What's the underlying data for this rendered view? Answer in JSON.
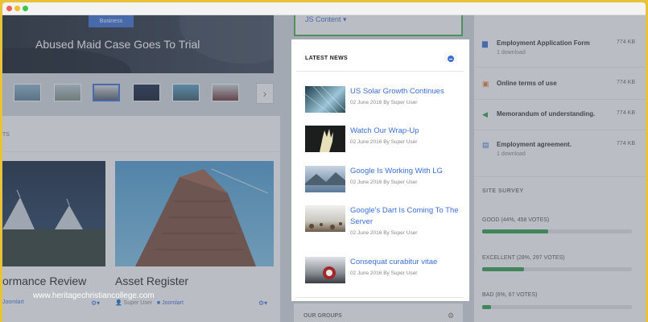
{
  "window": {
    "controls": [
      "close",
      "minimize",
      "maximize"
    ]
  },
  "hero": {
    "badge": "Business",
    "title": "Abused Maid Case Goes To Trial"
  },
  "thumbnails": {
    "count": 8,
    "selected_index": 3,
    "next_icon": "chevron-right-icon"
  },
  "left_panel": {
    "heading": "TS",
    "cards": [
      {
        "title": "ormance Review",
        "author": "",
        "category": "Joomlart"
      },
      {
        "title": "Asset Register",
        "author": "Super User",
        "category": "Joomlart"
      }
    ]
  },
  "top_box": {
    "label": "JS Content ▾"
  },
  "news": {
    "heading": "LATEST NEWS",
    "items": [
      {
        "title": "US Solar Growth Continues",
        "meta": "02 June 2016 By Super User"
      },
      {
        "title": "Watch Our Wrap-Up",
        "meta": "02 June 2016 By Super User"
      },
      {
        "title": "Google Is Working With LG",
        "meta": "02 June 2016 By Super User"
      },
      {
        "title": "Google's Dart Is Coming To The Server",
        "meta": "02 June 2016 By Super User"
      },
      {
        "title": "Consequat curabitur vitae",
        "meta": "02 June 2016 By Super User"
      }
    ]
  },
  "downloads": [
    {
      "name": "Employment Application Form",
      "size": "774 KB",
      "sub": "1 download",
      "icon": "file-icon"
    },
    {
      "name": "Online terms of use",
      "size": "774 KB",
      "sub": "",
      "icon": "film-icon"
    },
    {
      "name": "Memorandum of understanding.",
      "size": "774 KB",
      "sub": "",
      "icon": "speaker-icon"
    },
    {
      "name": "Employment agreement.",
      "size": "774 KB",
      "sub": "1 download",
      "icon": "database-icon"
    }
  ],
  "survey": {
    "heading": "SITE SURVEY",
    "options": [
      {
        "label": "GOOD (44%, 458 VOTES)",
        "percent": 44
      },
      {
        "label": "EXCELLENT (28%, 297 VOTES)",
        "percent": 28
      },
      {
        "label": "BAD (6%, 67 VOTES)",
        "percent": 6
      }
    ]
  },
  "groups": {
    "label": "OUR GROUPS"
  },
  "watermark": "www.heritagechristiancollege.com"
}
